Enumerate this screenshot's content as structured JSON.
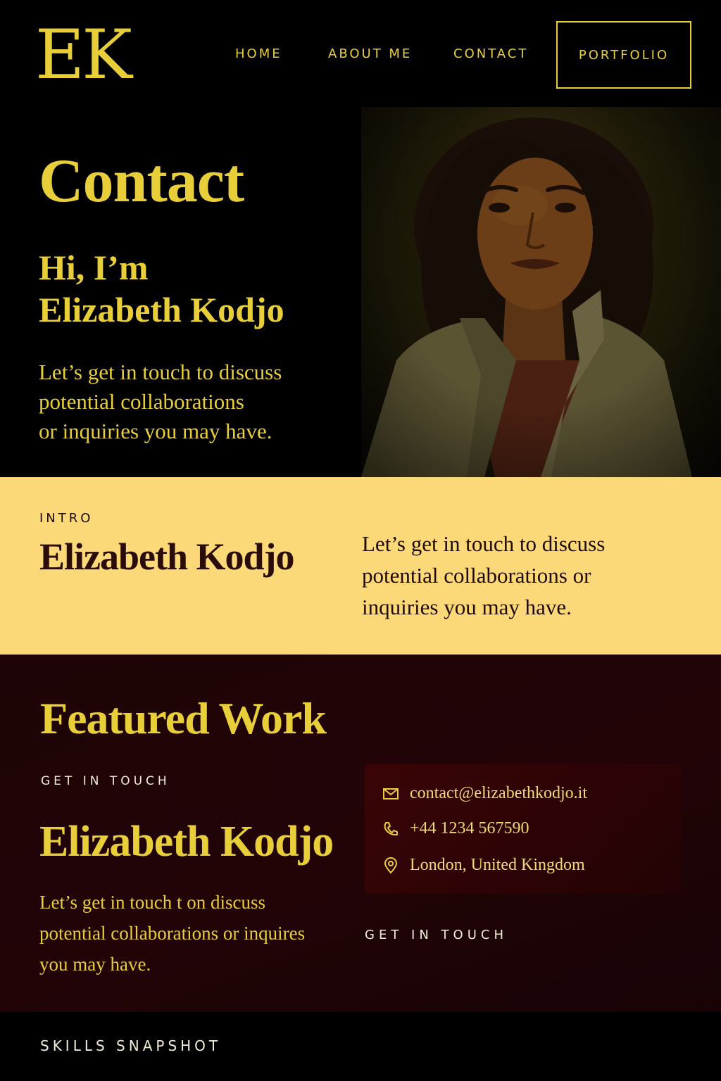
{
  "header": {
    "logo": "EK",
    "nav": {
      "home": "HOME",
      "about": "ABOUT ME",
      "contact": "CONTACT",
      "portfolio": "PORTFOLIO"
    }
  },
  "hero": {
    "title": "Contact",
    "greeting_line1": "Hi, I’m",
    "greeting_line2": "Elizabeth Kodjo",
    "text_line1": "Let’s get in touch to discuss",
    "text_line2": "potential collaborations",
    "text_line3": "or inquiries you may have."
  },
  "intro": {
    "label": "INTRO",
    "name": "Elizabeth Kodjo",
    "text_line1": "Let’s get in touch to discuss",
    "text_line2": "potential collaborations or",
    "text_line3": "inquiries you may have."
  },
  "featured": {
    "title": "Featured Work",
    "label": "GET IN TOUCH",
    "name": "Elizabeth Kodjo",
    "text_line1": "Let’s get in touch t on discuss",
    "text_line2": "potential collaborations or inquires",
    "text_line3": "you may have.",
    "contact": {
      "email": "contact@elizabethkodjo.it",
      "phone": "+44 1234 567590",
      "location": "London, United Kingdom"
    },
    "cta": "GET IN TOUCH"
  },
  "skills": {
    "label": "SKILLS SNAPSHOT"
  },
  "icons": {
    "email": "mail-icon",
    "phone": "phone-icon",
    "location": "map-pin-icon"
  },
  "colors": {
    "accent_gold": "#e8cf3a",
    "intro_band": "#fcd978",
    "featured_bg": "#1e0406",
    "card_bg": "#3a0406",
    "page_bg": "#000000"
  }
}
